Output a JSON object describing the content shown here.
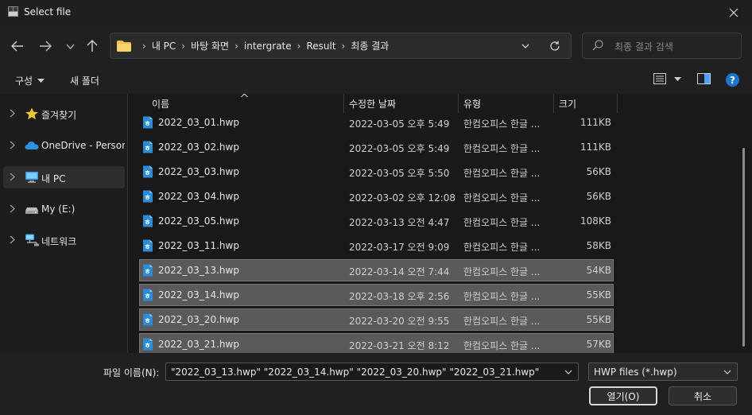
{
  "window": {
    "title": "Select file"
  },
  "address": {
    "crumbs": [
      "내 PC",
      "바탕 화면",
      "intergrate",
      "Result",
      "최종 결과"
    ]
  },
  "search": {
    "placeholder": "최종 결과 검색"
  },
  "toolbar": {
    "organize": "구성",
    "new_folder": "새 폴더"
  },
  "sidebar": {
    "items": [
      {
        "label": "즐겨찾기",
        "icon": "star-icon"
      },
      {
        "label": "OneDrive - Persona",
        "icon": "cloud-icon"
      },
      {
        "label": "내 PC",
        "icon": "computer-icon"
      },
      {
        "label": "My (E:)",
        "icon": "drive-icon"
      },
      {
        "label": "네트워크",
        "icon": "network-icon"
      }
    ]
  },
  "columns": {
    "name": "이름",
    "date": "수정한 날짜",
    "type": "유형",
    "size": "크기"
  },
  "files": [
    {
      "name": "2022_03_01.hwp",
      "date": "2022-03-05 오후 5:49",
      "type": "한컴오피스 한글 ...",
      "size": "111KB",
      "selected": false
    },
    {
      "name": "2022_03_02.hwp",
      "date": "2022-03-05 오후 5:49",
      "type": "한컴오피스 한글 ...",
      "size": "111KB",
      "selected": false
    },
    {
      "name": "2022_03_03.hwp",
      "date": "2022-03-05 오후 5:50",
      "type": "한컴오피스 한글 ...",
      "size": "56KB",
      "selected": false
    },
    {
      "name": "2022_03_04.hwp",
      "date": "2022-03-02 오후 12:08",
      "type": "한컴오피스 한글 ...",
      "size": "56KB",
      "selected": false
    },
    {
      "name": "2022_03_05.hwp",
      "date": "2022-03-13 오전 4:47",
      "type": "한컴오피스 한글 ...",
      "size": "108KB",
      "selected": false
    },
    {
      "name": "2022_03_11.hwp",
      "date": "2022-03-17 오전 9:09",
      "type": "한컴오피스 한글 ...",
      "size": "58KB",
      "selected": false
    },
    {
      "name": "2022_03_13.hwp",
      "date": "2022-03-14 오전 7:44",
      "type": "한컴오피스 한글 ...",
      "size": "54KB",
      "selected": true
    },
    {
      "name": "2022_03_14.hwp",
      "date": "2022-03-18 오후 2:56",
      "type": "한컴오피스 한글 ...",
      "size": "55KB",
      "selected": true
    },
    {
      "name": "2022_03_20.hwp",
      "date": "2022-03-20 오전 9:55",
      "type": "한컴오피스 한글 ...",
      "size": "55KB",
      "selected": true
    },
    {
      "name": "2022_03_21.hwp",
      "date": "2022-03-21 오전 8:12",
      "type": "한컴오피스 한글 ...",
      "size": "57KB",
      "selected": true
    }
  ],
  "bottom": {
    "filename_label": "파일 이름(N):",
    "filename_value": "\"2022_03_13.hwp\" \"2022_03_14.hwp\" \"2022_03_20.hwp\" \"2022_03_21.hwp\"",
    "filetype": "HWP files (*.hwp)",
    "open_button": "열기(O)",
    "cancel_button": "취소"
  },
  "colors": {
    "selection": "#5a5a5a",
    "accent": "#0078d4",
    "folder": "#f3c24a"
  }
}
